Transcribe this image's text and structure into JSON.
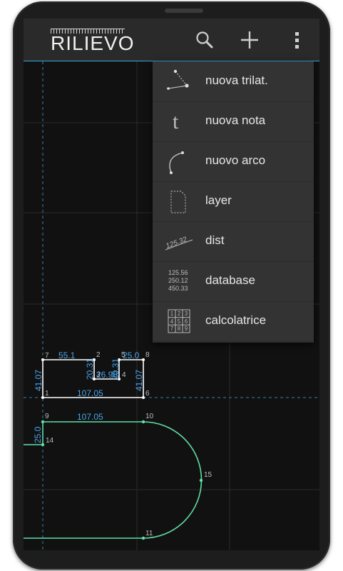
{
  "app": {
    "title": "RILIEVO"
  },
  "toolbar": {
    "search_icon": "search-icon",
    "add_icon": "plus-icon",
    "overflow_icon": "more-vert-icon"
  },
  "menu": {
    "items": [
      {
        "label": "nuova trilat.",
        "icon": "triangle-points-icon"
      },
      {
        "label": "nuova nota",
        "icon": "note-t-icon"
      },
      {
        "label": "nuovo arco",
        "icon": "arc-icon"
      },
      {
        "label": "layer",
        "icon": "layer-page-icon"
      },
      {
        "label": "dist",
        "icon": "distance-icon",
        "icon_text": "125.32"
      },
      {
        "label": "database",
        "icon": "database-icon",
        "icon_lines": [
          "125.56",
          "250.12",
          "450.33"
        ]
      },
      {
        "label": "calcolatrice",
        "icon": "calculator-icon",
        "icon_keys": [
          "1",
          "2",
          "3",
          "4",
          "5",
          "6",
          "7",
          "8",
          "9"
        ]
      }
    ]
  },
  "drawing": {
    "points": {
      "p1": "1",
      "p2": "2",
      "p3": "3",
      "p4": "4",
      "p5": "5",
      "p6": "6",
      "p7": "7",
      "p8": "8",
      "p9": "9",
      "p10": "10",
      "p11": "11",
      "p14": "14",
      "p15": "15"
    },
    "dims": {
      "top_left": "55.1",
      "top_right": "25.0",
      "left_side": "41.07",
      "right_side": "41.07",
      "notch_left": "20.31",
      "notch_right": "20.31",
      "notch_bottom": "26.98",
      "bottom": "107.05",
      "green_top": "107.05",
      "green_left": "25.0"
    },
    "colors": {
      "accent": "#37a9d8",
      "polygon": "#ffffff",
      "path": "#5fe0a8",
      "dimension": "#4aa3e8"
    }
  }
}
